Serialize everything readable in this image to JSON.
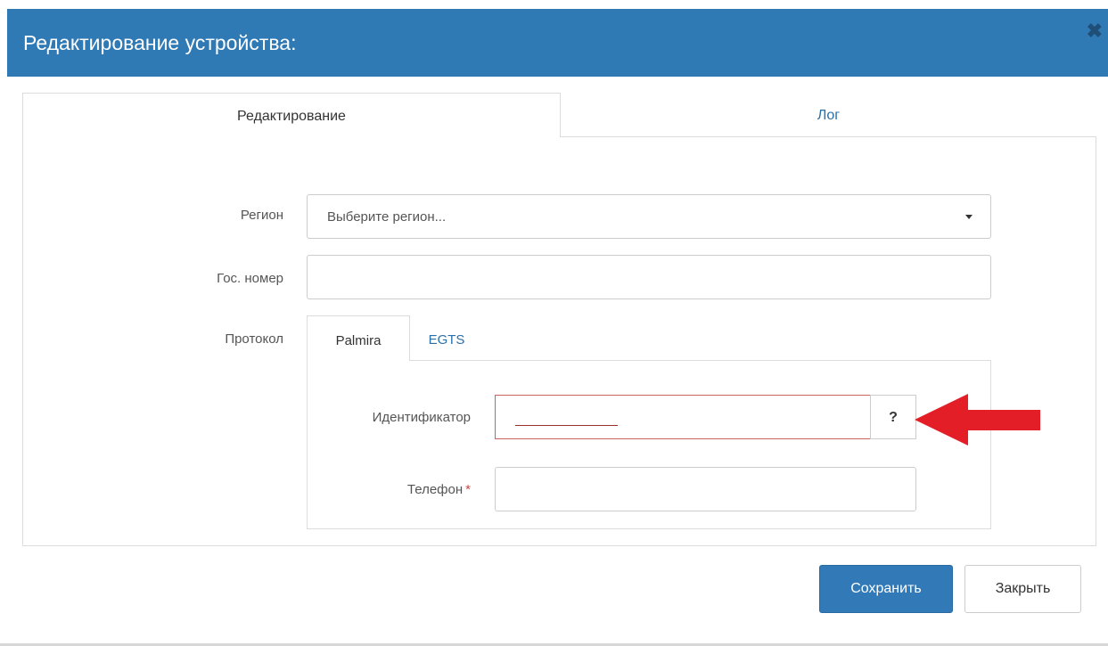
{
  "dialog": {
    "title": "Редактирование устройства:",
    "close_icon": "close-icon"
  },
  "tabs": [
    {
      "label": "Редактирование",
      "active": true
    },
    {
      "label": "Лог",
      "active": false
    }
  ],
  "form": {
    "region": {
      "label": "Регион",
      "placeholder": "Выберите регион..."
    },
    "plate": {
      "label": "Гос. номер",
      "value": ""
    },
    "protocol": {
      "label": "Протокол",
      "tabs": [
        {
          "label": "Palmira",
          "active": true
        },
        {
          "label": "EGTS",
          "active": false
        }
      ],
      "identifier": {
        "label": "Идентификатор",
        "help_label": "?"
      },
      "phone": {
        "label": "Телефон",
        "required_mark": "*",
        "value": ""
      }
    }
  },
  "footer": {
    "save_label": "Сохранить",
    "close_label": "Закрыть"
  },
  "colors": {
    "header": "#2f79b5",
    "primary_button": "#3279b7",
    "error_border": "#c8625f",
    "annotation_arrow": "#e41e26"
  }
}
